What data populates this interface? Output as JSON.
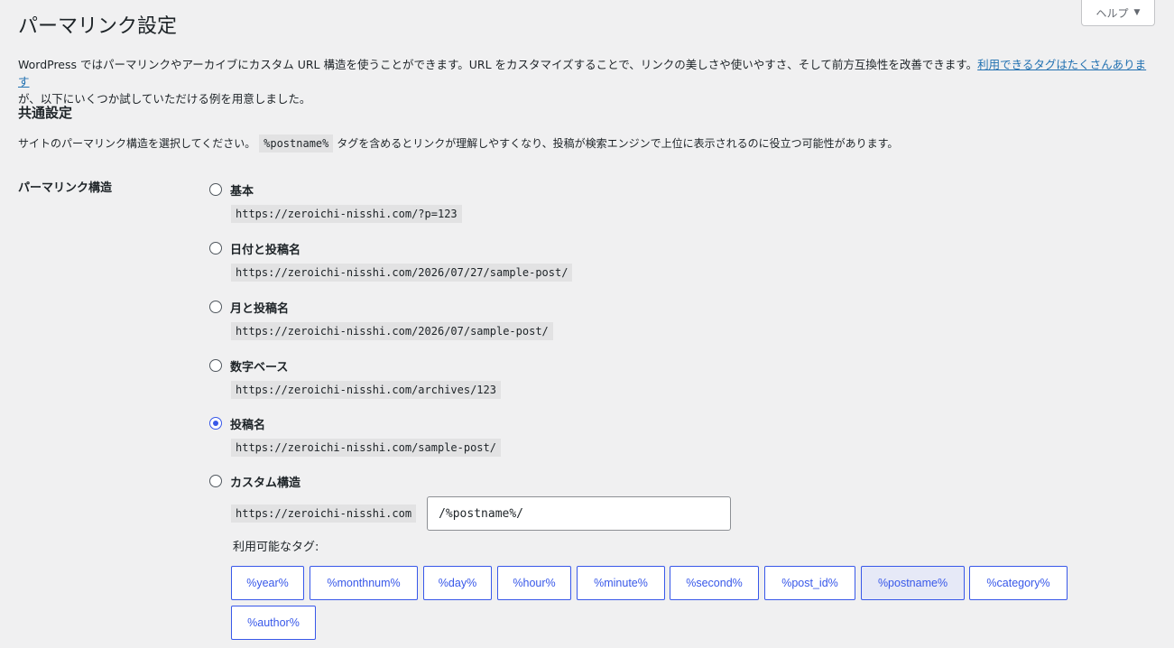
{
  "help_button": {
    "label": "ヘルプ",
    "arrow": "▼"
  },
  "page_title": "パーマリンク設定",
  "intro": {
    "text": "WordPress ではパーマリンクやアーカイブにカスタム URL 構造を使うことができます。URL をカスタマイズすることで、リンクの美しさや使いやすさ、そして前方互換性を改善できます。",
    "link": "利用できるタグはたくさんあります",
    "text2": "が、以下にいくつか試していただける例を用意しました。"
  },
  "common": {
    "heading": "共通設定",
    "desc_before": "サイトのパーマリンク構造を選択してください。",
    "desc_code": "%postname%",
    "desc_after": "タグを含めるとリンクが理解しやすくなり、投稿が検索エンジンで上位に表示されるのに役立つ可能性があります。"
  },
  "structure_label": "パーマリンク構造",
  "options": [
    {
      "label": "基本",
      "url": "https://zeroichi-nisshi.com/?p=123",
      "checked": false
    },
    {
      "label": "日付と投稿名",
      "url": "https://zeroichi-nisshi.com/2026/07/27/sample-post/",
      "checked": false
    },
    {
      "label": "月と投稿名",
      "url": "https://zeroichi-nisshi.com/2026/07/sample-post/",
      "checked": false
    },
    {
      "label": "数字ベース",
      "url": "https://zeroichi-nisshi.com/archives/123",
      "checked": false
    },
    {
      "label": "投稿名",
      "url": "https://zeroichi-nisshi.com/sample-post/",
      "checked": true
    }
  ],
  "custom": {
    "label": "カスタム構造",
    "base": "https://zeroichi-nisshi.com",
    "value": "/%postname%/"
  },
  "tags_label": "利用可能なタグ:",
  "tags": [
    "%year%",
    "%monthnum%",
    "%day%",
    "%hour%",
    "%minute%",
    "%second%",
    "%post_id%",
    "%postname%",
    "%category%",
    "%author%"
  ],
  "active_tag": "%postname%"
}
